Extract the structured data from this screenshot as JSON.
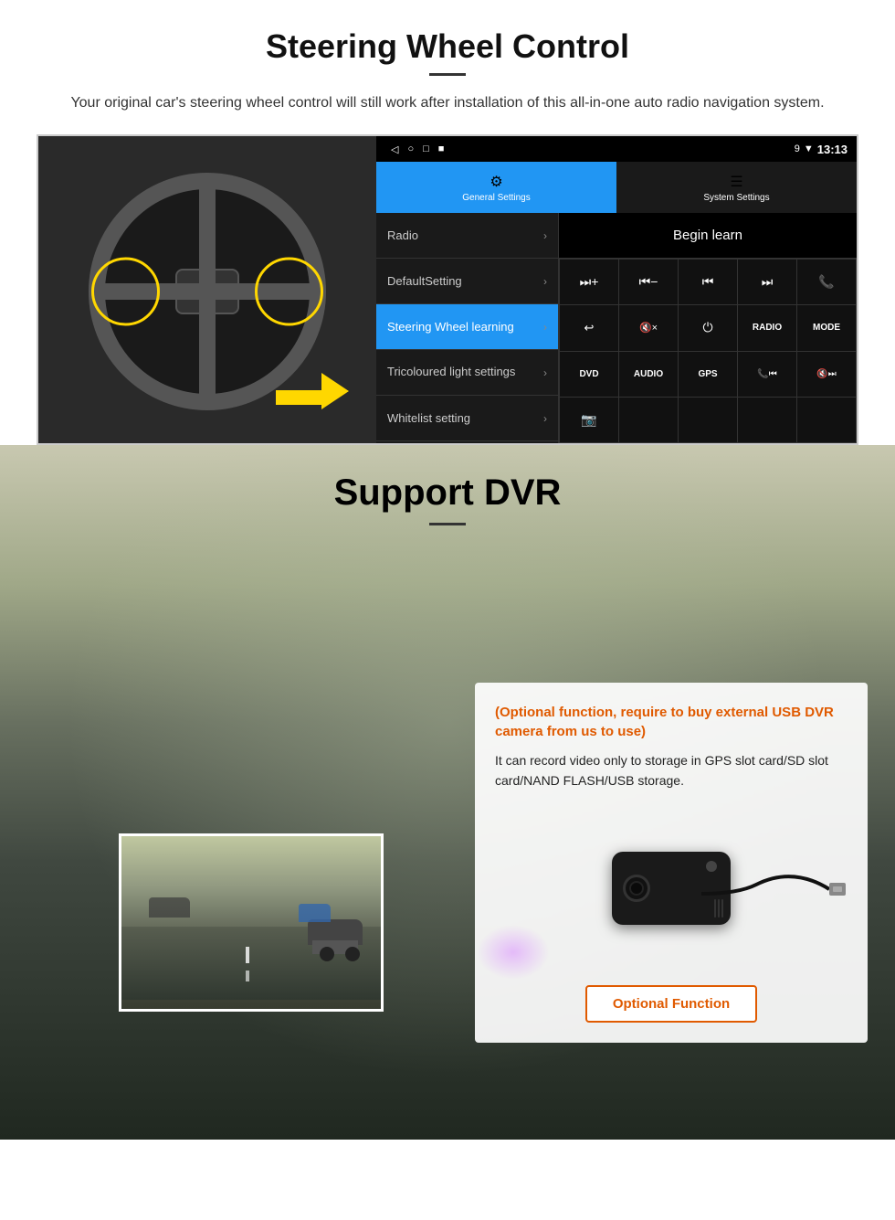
{
  "page": {
    "section1": {
      "title": "Steering Wheel Control",
      "subtitle": "Your original car's steering wheel control will still work after installation of this all-in-one auto radio navigation system.",
      "android": {
        "statusBar": {
          "leftIcons": [
            "◁",
            "○",
            "□",
            "■"
          ],
          "rightIcons": [
            "9",
            "▼",
            "13:13"
          ]
        },
        "tabs": [
          {
            "icon": "⚙",
            "label": "General Settings",
            "active": true
          },
          {
            "icon": "☰",
            "label": "System Settings",
            "active": false
          }
        ],
        "menu": [
          {
            "label": "Radio",
            "active": false
          },
          {
            "label": "DefaultSetting",
            "active": false
          },
          {
            "label": "Steering Wheel learning",
            "active": true
          },
          {
            "label": "Tricoloured light settings",
            "active": false
          },
          {
            "label": "Whitelist setting",
            "active": false
          }
        ],
        "beginLearn": "Begin learn",
        "buttons": [
          [
            "⏭+",
            "⏮−",
            "⏮⏮",
            "⏭⏭",
            "📞"
          ],
          [
            "↩",
            "🔇×",
            "⏻",
            "RADIO",
            "MODE"
          ],
          [
            "DVD",
            "AUDIO",
            "GPS",
            "📞⏮",
            "🔇⏭"
          ],
          [
            "📷",
            "",
            "",
            "",
            ""
          ]
        ]
      }
    },
    "section2": {
      "title": "Support DVR",
      "optionalText": "(Optional function, require to buy external USB DVR camera from us to use)",
      "descText": "It can record video only to storage in GPS slot card/SD slot card/NAND FLASH/USB storage.",
      "optionalButton": "Optional Function"
    }
  }
}
